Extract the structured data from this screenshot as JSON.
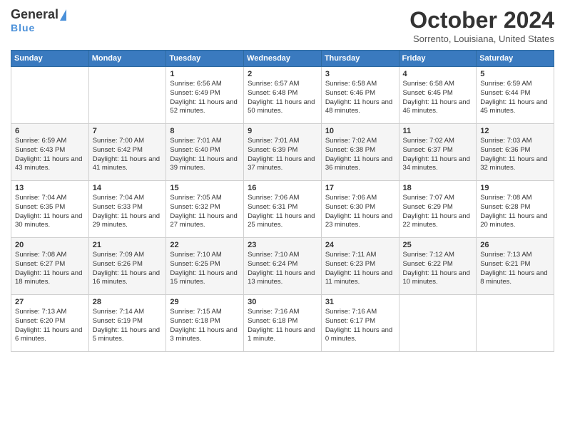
{
  "header": {
    "logo_general": "General",
    "logo_blue": "Blue",
    "month_title": "October 2024",
    "location": "Sorrento, Louisiana, United States"
  },
  "days_of_week": [
    "Sunday",
    "Monday",
    "Tuesday",
    "Wednesday",
    "Thursday",
    "Friday",
    "Saturday"
  ],
  "weeks": [
    [
      {
        "day": "",
        "info": ""
      },
      {
        "day": "",
        "info": ""
      },
      {
        "day": "1",
        "info": "Sunrise: 6:56 AM\nSunset: 6:49 PM\nDaylight: 11 hours and 52 minutes."
      },
      {
        "day": "2",
        "info": "Sunrise: 6:57 AM\nSunset: 6:48 PM\nDaylight: 11 hours and 50 minutes."
      },
      {
        "day": "3",
        "info": "Sunrise: 6:58 AM\nSunset: 6:46 PM\nDaylight: 11 hours and 48 minutes."
      },
      {
        "day": "4",
        "info": "Sunrise: 6:58 AM\nSunset: 6:45 PM\nDaylight: 11 hours and 46 minutes."
      },
      {
        "day": "5",
        "info": "Sunrise: 6:59 AM\nSunset: 6:44 PM\nDaylight: 11 hours and 45 minutes."
      }
    ],
    [
      {
        "day": "6",
        "info": "Sunrise: 6:59 AM\nSunset: 6:43 PM\nDaylight: 11 hours and 43 minutes."
      },
      {
        "day": "7",
        "info": "Sunrise: 7:00 AM\nSunset: 6:42 PM\nDaylight: 11 hours and 41 minutes."
      },
      {
        "day": "8",
        "info": "Sunrise: 7:01 AM\nSunset: 6:40 PM\nDaylight: 11 hours and 39 minutes."
      },
      {
        "day": "9",
        "info": "Sunrise: 7:01 AM\nSunset: 6:39 PM\nDaylight: 11 hours and 37 minutes."
      },
      {
        "day": "10",
        "info": "Sunrise: 7:02 AM\nSunset: 6:38 PM\nDaylight: 11 hours and 36 minutes."
      },
      {
        "day": "11",
        "info": "Sunrise: 7:02 AM\nSunset: 6:37 PM\nDaylight: 11 hours and 34 minutes."
      },
      {
        "day": "12",
        "info": "Sunrise: 7:03 AM\nSunset: 6:36 PM\nDaylight: 11 hours and 32 minutes."
      }
    ],
    [
      {
        "day": "13",
        "info": "Sunrise: 7:04 AM\nSunset: 6:35 PM\nDaylight: 11 hours and 30 minutes."
      },
      {
        "day": "14",
        "info": "Sunrise: 7:04 AM\nSunset: 6:33 PM\nDaylight: 11 hours and 29 minutes."
      },
      {
        "day": "15",
        "info": "Sunrise: 7:05 AM\nSunset: 6:32 PM\nDaylight: 11 hours and 27 minutes."
      },
      {
        "day": "16",
        "info": "Sunrise: 7:06 AM\nSunset: 6:31 PM\nDaylight: 11 hours and 25 minutes."
      },
      {
        "day": "17",
        "info": "Sunrise: 7:06 AM\nSunset: 6:30 PM\nDaylight: 11 hours and 23 minutes."
      },
      {
        "day": "18",
        "info": "Sunrise: 7:07 AM\nSunset: 6:29 PM\nDaylight: 11 hours and 22 minutes."
      },
      {
        "day": "19",
        "info": "Sunrise: 7:08 AM\nSunset: 6:28 PM\nDaylight: 11 hours and 20 minutes."
      }
    ],
    [
      {
        "day": "20",
        "info": "Sunrise: 7:08 AM\nSunset: 6:27 PM\nDaylight: 11 hours and 18 minutes."
      },
      {
        "day": "21",
        "info": "Sunrise: 7:09 AM\nSunset: 6:26 PM\nDaylight: 11 hours and 16 minutes."
      },
      {
        "day": "22",
        "info": "Sunrise: 7:10 AM\nSunset: 6:25 PM\nDaylight: 11 hours and 15 minutes."
      },
      {
        "day": "23",
        "info": "Sunrise: 7:10 AM\nSunset: 6:24 PM\nDaylight: 11 hours and 13 minutes."
      },
      {
        "day": "24",
        "info": "Sunrise: 7:11 AM\nSunset: 6:23 PM\nDaylight: 11 hours and 11 minutes."
      },
      {
        "day": "25",
        "info": "Sunrise: 7:12 AM\nSunset: 6:22 PM\nDaylight: 11 hours and 10 minutes."
      },
      {
        "day": "26",
        "info": "Sunrise: 7:13 AM\nSunset: 6:21 PM\nDaylight: 11 hours and 8 minutes."
      }
    ],
    [
      {
        "day": "27",
        "info": "Sunrise: 7:13 AM\nSunset: 6:20 PM\nDaylight: 11 hours and 6 minutes."
      },
      {
        "day": "28",
        "info": "Sunrise: 7:14 AM\nSunset: 6:19 PM\nDaylight: 11 hours and 5 minutes."
      },
      {
        "day": "29",
        "info": "Sunrise: 7:15 AM\nSunset: 6:18 PM\nDaylight: 11 hours and 3 minutes."
      },
      {
        "day": "30",
        "info": "Sunrise: 7:16 AM\nSunset: 6:18 PM\nDaylight: 11 hours and 1 minute."
      },
      {
        "day": "31",
        "info": "Sunrise: 7:16 AM\nSunset: 6:17 PM\nDaylight: 11 hours and 0 minutes."
      },
      {
        "day": "",
        "info": ""
      },
      {
        "day": "",
        "info": ""
      }
    ]
  ]
}
